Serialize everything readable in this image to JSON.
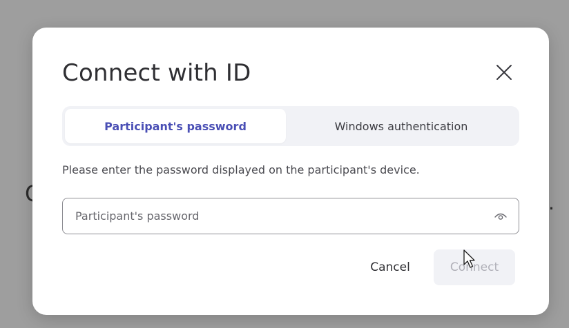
{
  "backdrop": {
    "left_fragment": "C",
    "right_fragment": "."
  },
  "dialog": {
    "title": "Connect with ID",
    "close_icon": "close-icon",
    "tabs": [
      {
        "label": "Participant's password",
        "active": true
      },
      {
        "label": "Windows authentication",
        "active": false
      }
    ],
    "hint": "Please enter the password displayed on the participant's device.",
    "password_field": {
      "placeholder": "Participant's password",
      "value": "",
      "toggle_icon": "eye-icon"
    },
    "cancel_label": "Cancel",
    "connect_label": "Connect",
    "connect_enabled": false
  },
  "colors": {
    "accent": "#4a4fb5",
    "overlay": "#9e9e9e",
    "tab_track": "#f1f2f6",
    "disabled_text": "#b0b0b8"
  }
}
